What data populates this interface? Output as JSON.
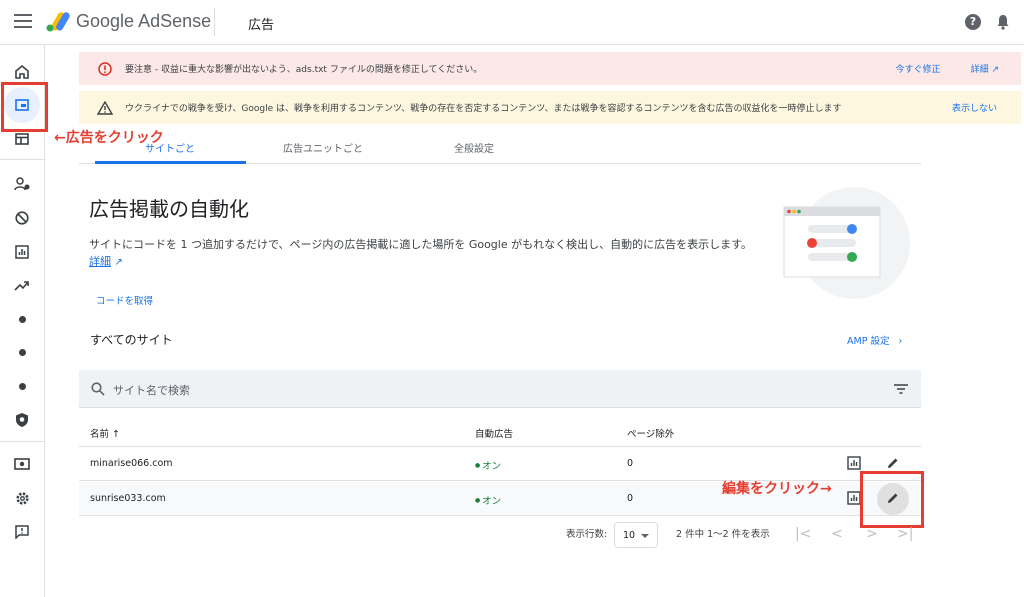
{
  "header": {
    "brand_google": "Google",
    "brand_adsense": "AdSense",
    "page_title": "広告"
  },
  "banners": {
    "error": {
      "text": "要注意 - 収益に重大な影響が出ないよう、ads.txt ファイルの問題を修正してください。",
      "action1": "今すぐ修正",
      "action2": "詳細"
    },
    "warning": {
      "text": "ウクライナでの戦争を受け、Google は、戦争を利用するコンテンツ、戦争の存在を否定するコンテンツ、または戦争を容認するコンテンツを含む広告の収益化を一時停止します",
      "action": "表示しない"
    }
  },
  "annotations": {
    "ads_click": "←広告をクリック",
    "edit_click": "編集をクリック→"
  },
  "tabs": [
    {
      "label": "サイトごと"
    },
    {
      "label": "広告ユニットごと"
    },
    {
      "label": "全般設定"
    }
  ],
  "auto_ads": {
    "title": "広告掲載の自動化",
    "description": "サイトにコードを 1 つ追加するだけで、ページ内の広告掲載に適した場所を Google がもれなく検出し、自動的に広告を表示します。",
    "details_link": "詳細",
    "get_code": "コードを取得"
  },
  "sites": {
    "heading": "すべてのサイト",
    "amp_settings": "AMP 設定",
    "search_placeholder": "サイト名で検索",
    "columns": [
      "名前 ↑",
      "自動広告",
      "ページ除外"
    ],
    "rows": [
      {
        "name": "minarise066.com",
        "auto_ads": "オン",
        "excluded": "0"
      },
      {
        "name": "sunrise033.com",
        "auto_ads": "オン",
        "excluded": "0"
      }
    ]
  },
  "pagination": {
    "rows_label": "表示行数:",
    "rows_value": "10",
    "range": "2 件中 1〜2 件を表示"
  },
  "colors": {
    "accent": "#1a73e8",
    "error_bg": "#fce8e6",
    "warning_bg": "#fef7e0",
    "annotation_red": "#e53d2f",
    "status_green": "#188038"
  }
}
